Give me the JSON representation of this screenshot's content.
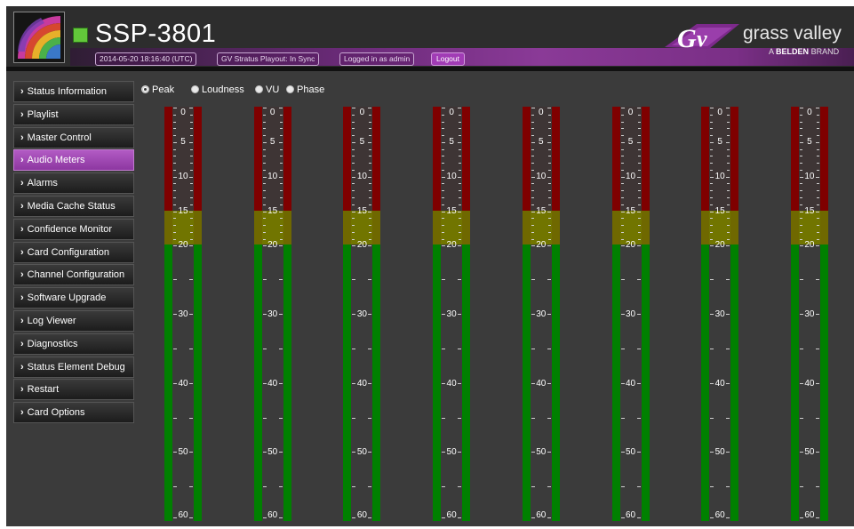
{
  "header": {
    "device_title": "SSP-3801",
    "timestamp": "2014-05-20 18:16:40 (UTC)",
    "playout_status": "GV Stratus Playout: In Sync",
    "login_status": "Logged in as admin",
    "logout_label": "Logout",
    "status_led_color": "#62c83a",
    "brand": {
      "name": "grass valley",
      "tagline_prefix": "A",
      "tagline_bold": "BELDEN",
      "tagline_suffix": "BRAND",
      "logo_icon": "gv-logo-icon"
    }
  },
  "sidebar": {
    "items": [
      {
        "label": "Status Information",
        "active": false
      },
      {
        "label": "Playlist",
        "active": false
      },
      {
        "label": "Master Control",
        "active": false
      },
      {
        "label": "Audio Meters",
        "active": true
      },
      {
        "label": "Alarms",
        "active": false
      },
      {
        "label": "Media Cache Status",
        "active": false
      },
      {
        "label": "Confidence Monitor",
        "active": false
      },
      {
        "label": "Card Configuration",
        "active": false
      },
      {
        "label": "Channel Configuration",
        "active": false
      },
      {
        "label": "Software Upgrade",
        "active": false
      },
      {
        "label": "Log Viewer",
        "active": false
      },
      {
        "label": "Diagnostics",
        "active": false
      },
      {
        "label": "Status Element Debug",
        "active": false
      },
      {
        "label": "Restart",
        "active": false
      },
      {
        "label": "Card Options",
        "active": false
      }
    ],
    "chevron": "›",
    "accent_color": "#9b44ae"
  },
  "meter_modes": {
    "options": [
      {
        "label": "Peak",
        "selected": true
      },
      {
        "label": "Loudness",
        "selected": false
      },
      {
        "label": "VU",
        "selected": false
      },
      {
        "label": "Phase",
        "selected": false
      }
    ]
  },
  "meters": {
    "count": 8,
    "scale_labels": [
      "0",
      "5",
      "10",
      "15",
      "20",
      "30",
      "40",
      "50",
      "60"
    ],
    "scale_values": [
      0,
      5,
      10,
      15,
      20,
      30,
      40,
      50,
      60
    ],
    "scale_min": 0,
    "scale_max": 60,
    "zones": {
      "red": {
        "from": 0,
        "to": 15,
        "color": "#7f0000"
      },
      "yellow": {
        "from": 15,
        "to": 20,
        "color": "#6f6800"
      },
      "green": {
        "from": 20,
        "to": 60,
        "color": "#008000"
      }
    },
    "levels": [
      0,
      0,
      0,
      0,
      0,
      0,
      0,
      0
    ]
  }
}
